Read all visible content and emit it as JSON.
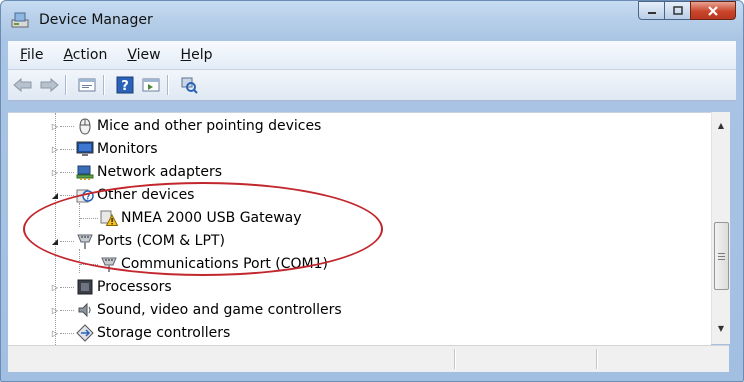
{
  "window": {
    "title": "Device Manager",
    "icons": {
      "app": "device-manager-icon",
      "minimize": "minimize-icon",
      "maximize": "maximize-icon",
      "close": "close-icon"
    }
  },
  "menubar": {
    "items": [
      {
        "label_first": "F",
        "label_rest": "ile"
      },
      {
        "label_first": "A",
        "label_rest": "ction"
      },
      {
        "label_first": "V",
        "label_rest": "iew"
      },
      {
        "label_first": "H",
        "label_rest": "elp"
      }
    ]
  },
  "toolbar": {
    "icons": [
      "back-arrow-icon",
      "forward-arrow-icon",
      "properties-icon",
      "help-icon",
      "view-icon",
      "scan-hardware-icon"
    ]
  },
  "tree": {
    "nodes": [
      {
        "label": "Mice and other pointing devices",
        "icon": "mouse-icon",
        "expanded": false
      },
      {
        "label": "Monitors",
        "icon": "monitor-icon",
        "expanded": false
      },
      {
        "label": "Network adapters",
        "icon": "network-adapter-icon",
        "expanded": false
      },
      {
        "label": "Other devices",
        "icon": "unknown-device-icon",
        "expanded": true
      },
      {
        "label": "NMEA 2000 USB Gateway",
        "icon": "warning-device-icon",
        "child": true
      },
      {
        "label": "Ports (COM & LPT)",
        "icon": "port-icon",
        "expanded": true
      },
      {
        "label": "Communications Port (COM1)",
        "icon": "port-icon",
        "child": true
      },
      {
        "label": "Processors",
        "icon": "processor-icon",
        "expanded": false
      },
      {
        "label": "Sound, video and game controllers",
        "icon": "speaker-icon",
        "expanded": false
      },
      {
        "label": "Storage controllers",
        "icon": "storage-icon",
        "expanded": false
      }
    ]
  },
  "colors": {
    "highlight": "#c2272d",
    "frame": "#a9c4e4"
  }
}
